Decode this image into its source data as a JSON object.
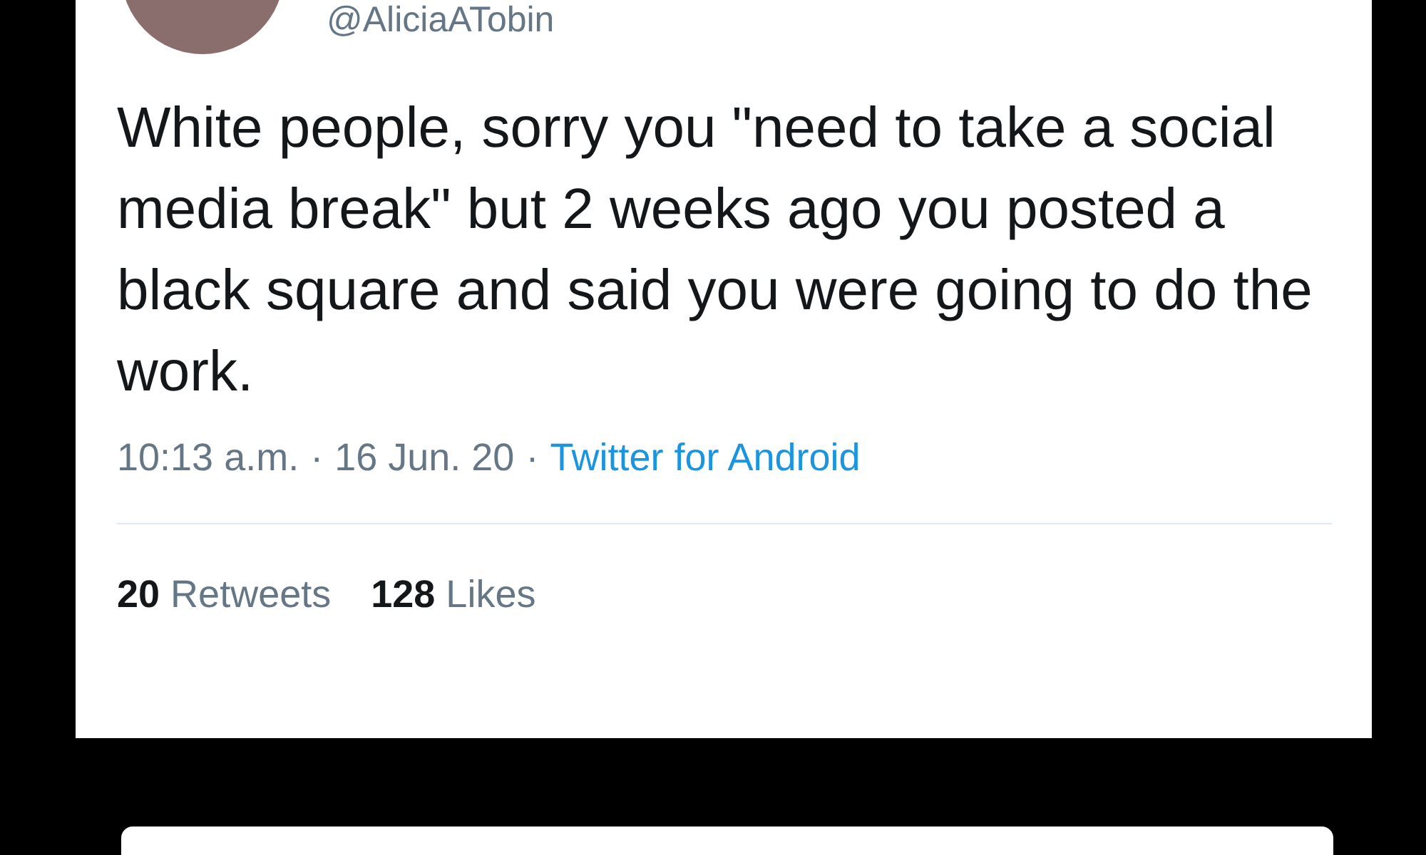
{
  "tweet": {
    "handle": "@AliciaATobin",
    "text": "White people, sorry you \"need to take a social media break\" but 2 weeks ago you posted a black square and said you were going to do the work.",
    "separator": "·",
    "time": "10:13 a.m.",
    "date": "16 Jun. 20",
    "source": "Twitter for Android",
    "stats": [
      {
        "count": "20",
        "label": "Retweets"
      },
      {
        "count": "128",
        "label": "Likes"
      }
    ]
  }
}
